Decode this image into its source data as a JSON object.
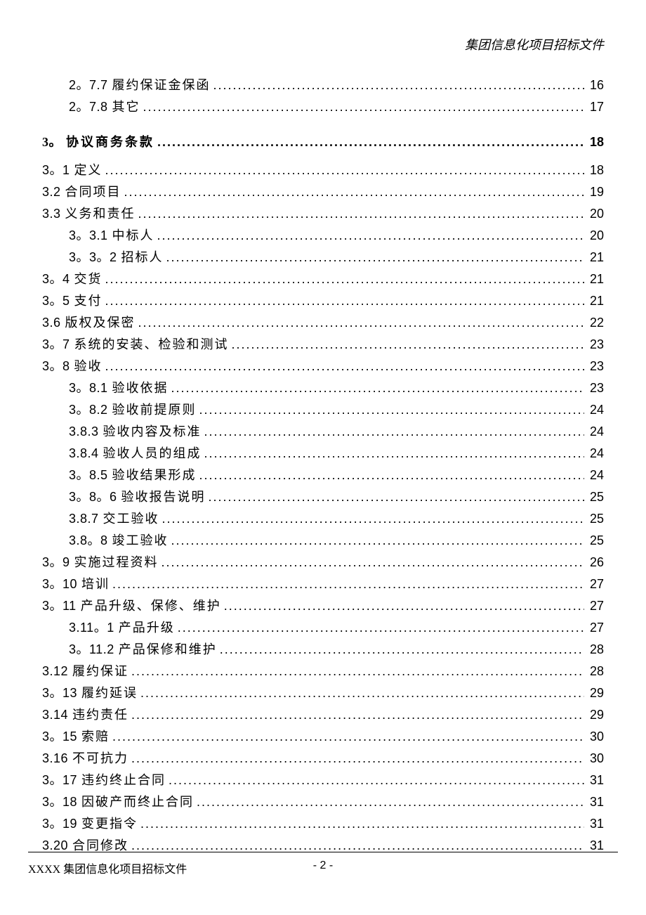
{
  "header": "集团信息化项目招标文件",
  "toc": [
    {
      "lvl": "lvl2",
      "num": "2。7.7",
      "title": "履约保证金保函",
      "page": "16"
    },
    {
      "lvl": "lvl2",
      "num": "2。7.8",
      "title": "其它",
      "page": "17"
    },
    {
      "lvl": "lvl0",
      "num": "3。",
      "title": "协议商务条款",
      "page": "18"
    },
    {
      "lvl": "lvl1",
      "num": "3。1",
      "title": "定义",
      "page": "18"
    },
    {
      "lvl": "lvl1",
      "num": "3.2",
      "title": "合同项目",
      "page": "19"
    },
    {
      "lvl": "lvl1",
      "num": "3.3",
      "title": "义务和责任",
      "page": "20"
    },
    {
      "lvl": "lvl2",
      "num": "3。3.1",
      "title": "中标人",
      "page": "20"
    },
    {
      "lvl": "lvl2",
      "num": "3。3。2",
      "title": "招标人",
      "page": "21"
    },
    {
      "lvl": "lvl1",
      "num": "3。4",
      "title": "交货",
      "page": "21"
    },
    {
      "lvl": "lvl1",
      "num": "3。5",
      "title": "支付",
      "page": "21"
    },
    {
      "lvl": "lvl1",
      "num": "3.6",
      "title": "版权及保密",
      "page": "22"
    },
    {
      "lvl": "lvl1",
      "num": "3。7",
      "title": "系统的安装、检验和测试",
      "page": "23"
    },
    {
      "lvl": "lvl1",
      "num": "3。8",
      "title": "验收",
      "page": "23"
    },
    {
      "lvl": "lvl2",
      "num": "3。8.1",
      "title": "验收依据",
      "page": "23"
    },
    {
      "lvl": "lvl2",
      "num": "3。8.2",
      "title": "验收前提原则",
      "page": "24"
    },
    {
      "lvl": "lvl2",
      "num": "3.8.3",
      "title": "验收内容及标准",
      "page": "24"
    },
    {
      "lvl": "lvl2",
      "num": "3.8.4",
      "title": "验收人员的组成",
      "page": "24"
    },
    {
      "lvl": "lvl2",
      "num": "3。8.5",
      "title": "验收结果形成",
      "page": "24"
    },
    {
      "lvl": "lvl2",
      "num": "3。8。6",
      "title": "验收报告说明",
      "page": "25"
    },
    {
      "lvl": "lvl2",
      "num": "3.8.7",
      "title": "交工验收",
      "page": "25"
    },
    {
      "lvl": "lvl2",
      "num": "3.8。8",
      "title": "竣工验收",
      "page": "25"
    },
    {
      "lvl": "lvl1",
      "num": "3。9",
      "title": "实施过程资料",
      "page": "26"
    },
    {
      "lvl": "lvl1",
      "num": "3。10",
      "title": "培训",
      "page": "27"
    },
    {
      "lvl": "lvl1",
      "num": "3。11",
      "title": "产品升级、保修、维护",
      "page": "27"
    },
    {
      "lvl": "lvl2",
      "num": "3.11。1",
      "title": "产品升级",
      "page": "27"
    },
    {
      "lvl": "lvl2",
      "num": "3。11.2",
      "title": "产品保修和维护",
      "page": "28"
    },
    {
      "lvl": "lvl1",
      "num": "3.12",
      "title": "履约保证",
      "page": "28"
    },
    {
      "lvl": "lvl1",
      "num": "3。13",
      "title": "履约延误",
      "page": "29"
    },
    {
      "lvl": "lvl1",
      "num": "3.14",
      "title": "违约责任",
      "page": "29"
    },
    {
      "lvl": "lvl1",
      "num": "3。15",
      "title": "索赔",
      "page": "30"
    },
    {
      "lvl": "lvl1",
      "num": "3.16",
      "title": "不可抗力",
      "page": "30"
    },
    {
      "lvl": "lvl1",
      "num": "3。17",
      "title": "违约终止合同",
      "page": "31"
    },
    {
      "lvl": "lvl1",
      "num": "3。18",
      "title": "因破产而终止合同",
      "page": "31"
    },
    {
      "lvl": "lvl1",
      "num": "3。19",
      "title": "变更指令",
      "page": "31"
    },
    {
      "lvl": "lvl1",
      "num": "3.20",
      "title": "合同修改",
      "page": "31"
    }
  ],
  "footer": {
    "left": "XXXX 集团信息化项目招标文件",
    "center": "- 2 -"
  }
}
